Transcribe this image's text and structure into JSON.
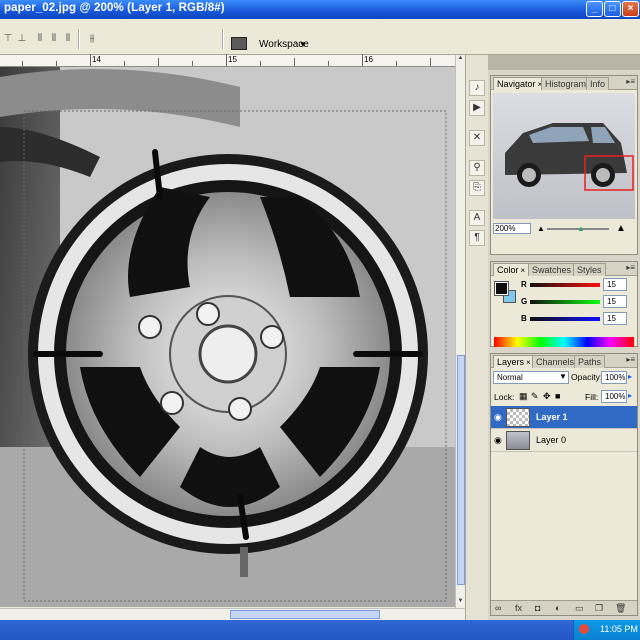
{
  "window": {
    "title": "paper_02.jpg @ 200% (Layer 1, RGB/8#)",
    "buttons": {
      "minimize": "_",
      "maximize": "□",
      "close": "×"
    }
  },
  "options_bar": {
    "workspace_label": "Workspace",
    "workspace_arrow": "▼"
  },
  "ruler": {
    "marks": [
      "14",
      "15",
      "16"
    ]
  },
  "navigator": {
    "tabs": [
      "Navigator",
      "Histogram",
      "Info"
    ],
    "zoom": "200%"
  },
  "color": {
    "tabs": [
      "Color",
      "Swatches",
      "Styles"
    ],
    "channels": [
      {
        "label": "R",
        "value": "15"
      },
      {
        "label": "G",
        "value": "15"
      },
      {
        "label": "B",
        "value": "15"
      }
    ],
    "foreground": "#0f0f0f",
    "background": "#7fc8ee"
  },
  "layers": {
    "tabs": [
      "Layers",
      "Channels",
      "Paths"
    ],
    "blend_mode": "Normal",
    "opacity_label": "Opacity:",
    "opacity": "100%",
    "lock_label": "Lock:",
    "fill_label": "Fill:",
    "fill": "100%",
    "items": [
      {
        "name": "Layer 1",
        "selected": true
      },
      {
        "name": "Layer 0",
        "selected": false
      }
    ]
  },
  "taskbar": {
    "clock": "11:05 PM"
  },
  "colors": {
    "title_blue": "#1756d8",
    "selection_blue": "#316ac5",
    "tray": "#0b7fd0"
  }
}
